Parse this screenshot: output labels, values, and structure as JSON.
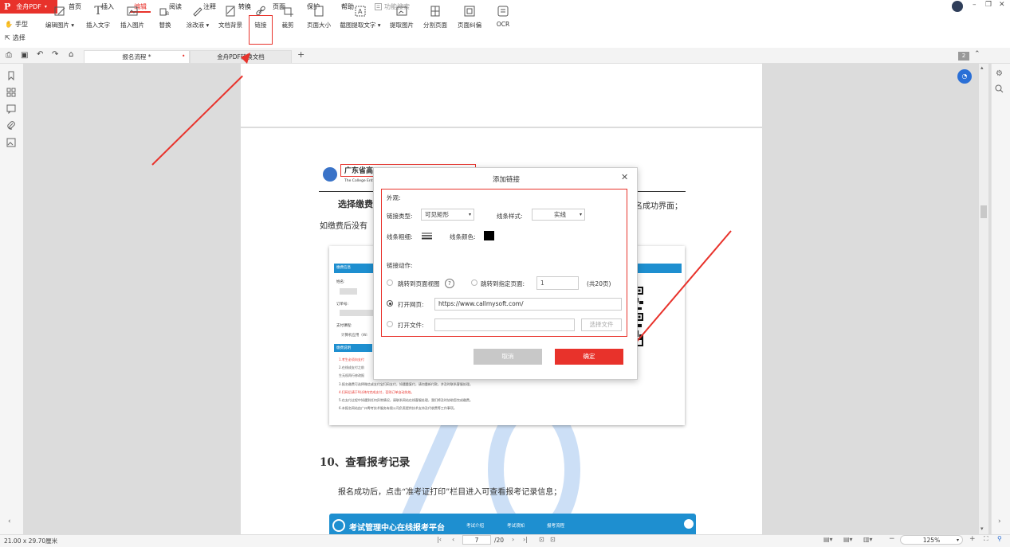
{
  "app": {
    "logo": "P",
    "name": "金舟PDF",
    "caret": "▾"
  },
  "menu": [
    "首页",
    "插入",
    "编辑",
    "阅读",
    "注释",
    "转换",
    "页面",
    "保护",
    "帮助"
  ],
  "function_search": {
    "placeholder": "功能搜索"
  },
  "window_controls": {
    "minimize": "–",
    "restore": "❐",
    "close": "✕"
  },
  "ribbon": {
    "hand": "手型",
    "select": "选择",
    "tools": [
      {
        "label": "编辑图片 ▾"
      },
      {
        "label": "插入文字"
      },
      {
        "label": "插入图片"
      },
      {
        "label": "替换"
      },
      {
        "label": "涂改液 ▾"
      },
      {
        "label": "文档背景"
      },
      {
        "label": "链接"
      },
      {
        "label": "裁剪"
      },
      {
        "label": "页面大小"
      },
      {
        "label": "截图提取文字 ▾"
      },
      {
        "label": "提取图片"
      },
      {
        "label": "分割页面"
      },
      {
        "label": "页面纠偏"
      },
      {
        "label": "OCR"
      }
    ]
  },
  "tabs": [
    {
      "label": "报名流程 *",
      "active": true
    },
    {
      "label": "金舟PDF转换文档",
      "active": false
    }
  ],
  "tab_add": "+",
  "page_count_badge": "2",
  "document": {
    "logo_text": "广东省高",
    "logo_sub": "The College Ent",
    "para1_bold": "选择缴费",
    "para1_right": "名成功界面；",
    "para2": "如缴费后没有",
    "heading": "10、查看报考记录",
    "para3": "报名成功后，点击“准考证打印”栏目进入可查看报考记录信息；",
    "banner_title": "考试管理中心在线报考平台",
    "banner_nav": [
      "考试介绍",
      "考试须知",
      "报考流程"
    ],
    "shot": {
      "section1": "缴费信息",
      "name_label": "姓名:",
      "order_label": "订单号:",
      "course_label": "支付课程:",
      "course_value": "计算机应用（Wi",
      "section2": "缴费说明",
      "notes": [
        "1.考生必须向支付",
        "2.在线成支付之前",
        "生无权再行修改报",
        "3.报名缴费可选择微信或支付宝扫码支付，如遇重复付，请勿重新付款，并及时联系客服处理。",
        "4.扫码后请于9分钟内完成支付，否则订单自动失效。",
        "5.在支付过程中如遇到任何异常情况，请联系网站在线客服处理，我们将及时协助您完成缴费。",
        "6.本报名网站由广州粤考技术服务有限公司负责提供技术支持及代收费等工作事项。"
      ]
    }
  },
  "dialog": {
    "title": "添加链接",
    "close": "✕",
    "appearance": "外观:",
    "link_type_label": "链接类型:",
    "link_type_value": "可见矩形",
    "line_style_label": "线条样式:",
    "line_style_value": "实线",
    "line_width_label": "线条粗细:",
    "line_color_label": "线条颜色:",
    "line_color": "#000000",
    "action_label": "链接动作:",
    "goto_view": "跳转到页面视图",
    "help": "?",
    "goto_page": "跳转到指定页面:",
    "page_value": "1",
    "page_total": "(共20页)",
    "open_web": "打开网页:",
    "url": "https://www.callmysoft.com/",
    "open_file": "打开文件:",
    "choose_file": "选择文件",
    "cancel": "取消",
    "ok": "确定"
  },
  "status": {
    "page_size": "21.00 x 29.70厘米",
    "current_page": "7",
    "total_pages": "/20",
    "zoom": "125%"
  },
  "colors": {
    "accent": "#e8322b",
    "dialog_ok": "#e8322b",
    "dialog_cancel": "#c8c8c8",
    "banner": "#1e8fd0"
  }
}
